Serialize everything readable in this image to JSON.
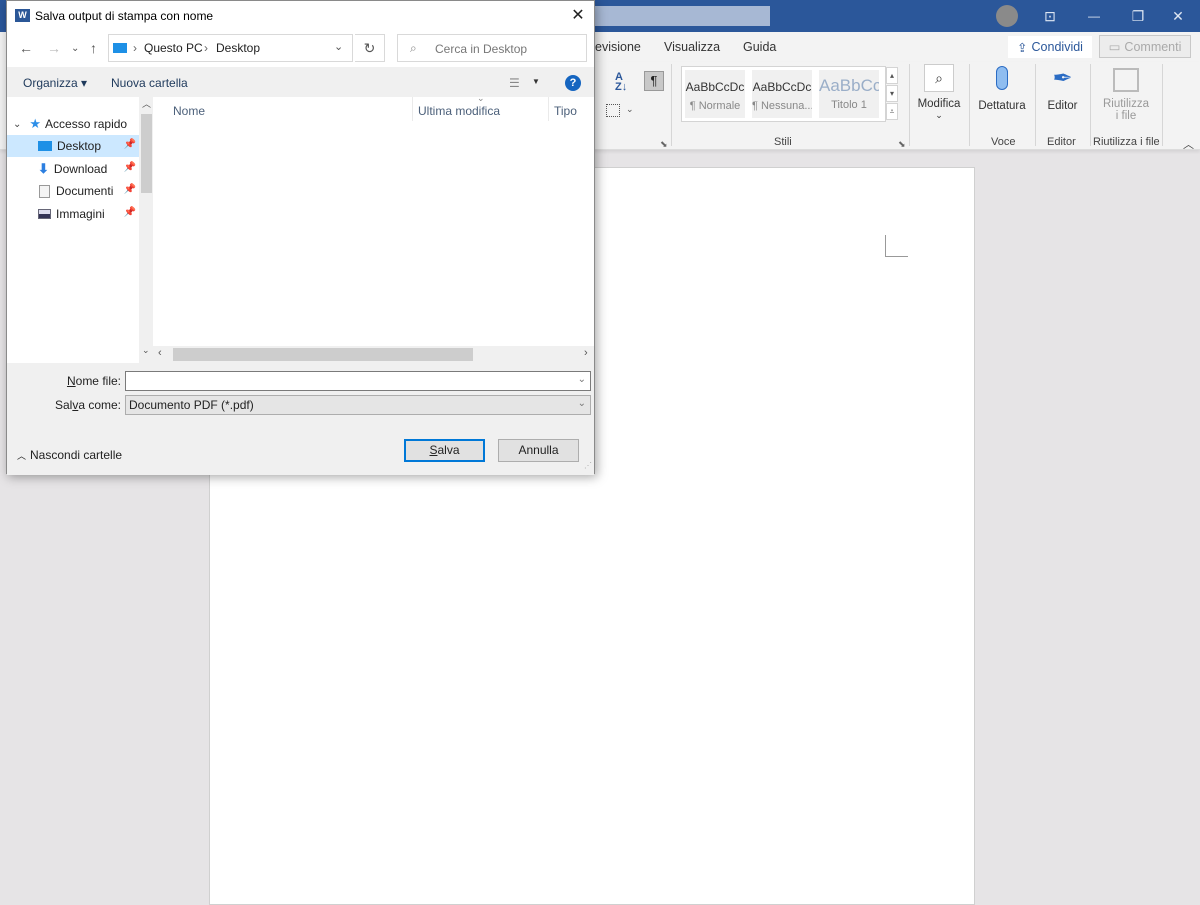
{
  "word": {
    "window_controls": {
      "ribbon_display": "⊡",
      "minimize": "—",
      "restore": "❐",
      "close": "✕"
    },
    "tabs": [
      "evisione",
      "Visualizza",
      "Guida"
    ],
    "share_label": "Condividi",
    "comments_label": "Commenti",
    "styles": [
      {
        "preview": "AaBbCcDc",
        "name": "¶ Normale"
      },
      {
        "preview": "AaBbCcDc",
        "name": "¶ Nessuna..."
      },
      {
        "preview": "AaBbCc",
        "name": "Titolo 1"
      }
    ],
    "groups": {
      "stili": "Stili",
      "voce": "Voce",
      "editor": "Editor",
      "riutilizza": "Riutilizza i file"
    },
    "buttons": {
      "modifica": "Modifica",
      "dettatura": "Dettatura",
      "editor": "Editor",
      "riutilizza_line1": "Riutilizza",
      "riutilizza_line2": "i file"
    },
    "colors": {
      "accent": "#2b579a"
    }
  },
  "dialog": {
    "title": "Salva output di stampa con nome",
    "app_icon": "W",
    "breadcrumb": [
      "Questo PC",
      "Desktop"
    ],
    "search_placeholder": "Cerca in Desktop",
    "toolbar": {
      "organize": "Organizza ▾",
      "new_folder": "Nuova cartella",
      "help": "?"
    },
    "nav": {
      "root": "Accesso rapido",
      "items": [
        {
          "label": "Desktop",
          "selected": true
        },
        {
          "label": "Download",
          "selected": false
        },
        {
          "label": "Documenti",
          "selected": false
        },
        {
          "label": "Immagini",
          "selected": false
        }
      ]
    },
    "columns": [
      "Nome",
      "Ultima modifica",
      "Tipo"
    ],
    "filename_label_prefix": "N",
    "filename_label_rest": "ome file:",
    "filename_value": "",
    "savetype_label_a": "Sal",
    "savetype_label_u": "v",
    "savetype_label_b": "a come:",
    "savetype_value": "Documento PDF (*.pdf)",
    "hide_folders": "Nascondi cartelle",
    "save_u": "S",
    "save_rest": "alva",
    "cancel": "Annulla"
  }
}
